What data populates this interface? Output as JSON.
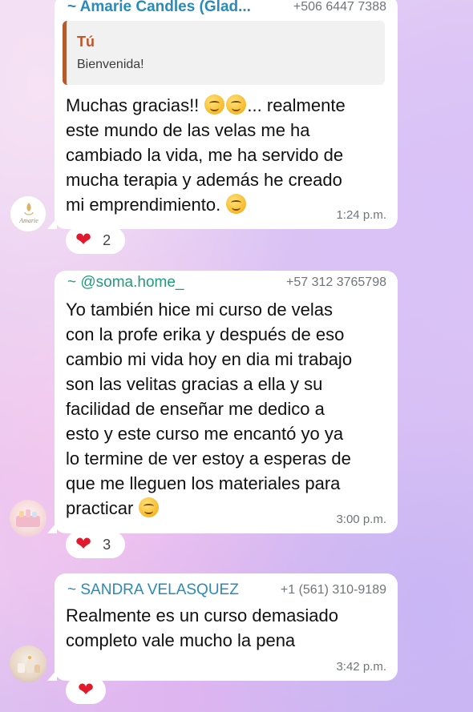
{
  "messages": [
    {
      "sender_name": "~ Amarie Candles (Glad...",
      "sender_phone": "+506 6447 7388",
      "sender_color": "#2a8ab8",
      "reply": {
        "author": "Tú",
        "text": "Bienvenida!"
      },
      "lines": [
        "Muchas gracias!!",
        "... realmente",
        "este mundo de las velas me ha",
        "cambiado la vida, me ha servido de",
        "mucha terapia y además he creado",
        "mi emprendimiento."
      ],
      "time": "1:24 p.m.",
      "reaction": {
        "emoji": "heart",
        "count": "2"
      },
      "avatar": {
        "type": "logo",
        "text": "Amarie"
      }
    },
    {
      "sender_name": "~ @soma.home_",
      "sender_phone": "+57 312 3765798",
      "sender_color": "#239a7a",
      "lines": [
        "Yo también hice mi curso de velas",
        "con la profe erika y después de eso",
        "cambio mi vida hoy en dia mi trabajo",
        "son las velitas gracias a ella y su",
        "facilidad de enseñar me dedico a",
        "esto y este curso me encantó yo ya",
        "lo termine de ver estoy a esperas de",
        "que me lleguen los materiales para",
        "practicar"
      ],
      "time": "3:00 p.m.",
      "reaction": {
        "emoji": "heart",
        "count": "3"
      },
      "avatar": {
        "type": "photo"
      }
    },
    {
      "sender_name": "~ SANDRA VELASQUEZ",
      "sender_phone": "+1 (561) 310-9189",
      "sender_color": "#2a8ab8",
      "lines": [
        "Realmente es un curso demasiado",
        "completo vale mucho la pena"
      ],
      "time": "3:42 p.m.",
      "reaction": {
        "emoji": "heart",
        "count": ""
      },
      "avatar": {
        "type": "photo"
      }
    }
  ]
}
